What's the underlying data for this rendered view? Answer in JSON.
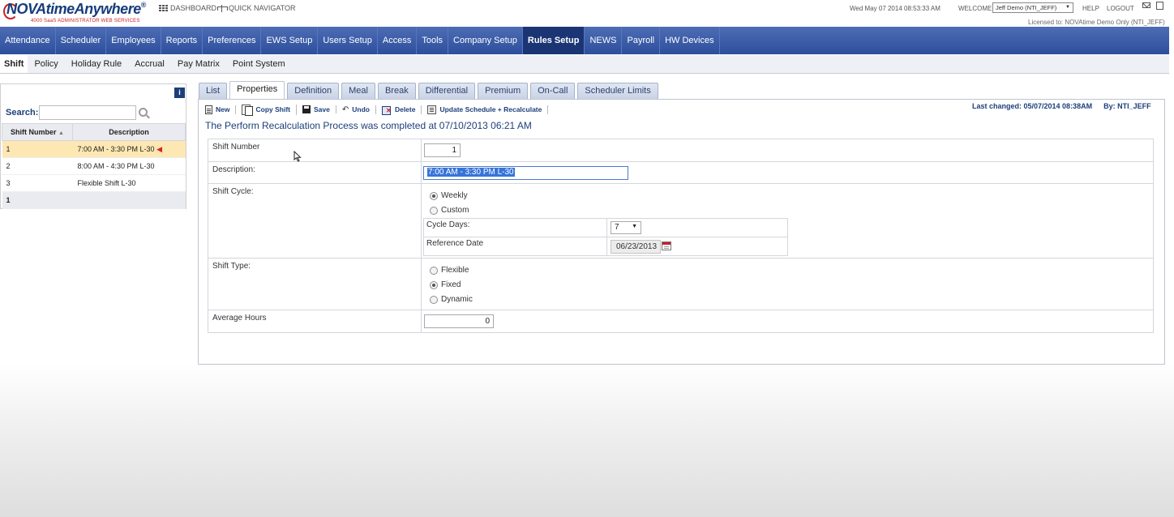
{
  "header": {
    "brand": "NOVAtimeAnywhere",
    "brand_reg": "®",
    "tagline": "4000 SaaS ADMINISTRATOR WEB SERVICES",
    "dashboard": "DASHBOARD",
    "quick_navigator": "QUICK NAVIGATOR",
    "datetime": "Wed May 07 2014 08:53:33 AM",
    "welcome": "WELCOME",
    "user": "Jeff Demo (NTI_JEFF)",
    "help": "HELP",
    "logout": "LOGOUT",
    "license": "Licensed to: NOVAtime Demo Only (NTI_JEFF)"
  },
  "main_nav": [
    "Attendance",
    "Scheduler",
    "Employees",
    "Reports",
    "Preferences",
    "EWS Setup",
    "Users Setup",
    "Access",
    "Tools",
    "Company Setup",
    "Rules Setup",
    "NEWS",
    "Payroll",
    "HW Devices"
  ],
  "main_nav_active": "Rules Setup",
  "sub_nav": [
    "Shift",
    "Policy",
    "Holiday Rule",
    "Accrual",
    "Pay Matrix",
    "Point System"
  ],
  "sub_nav_active": "Shift",
  "left_panel": {
    "info_label": "i",
    "search_label": "Search:",
    "search_value": "",
    "columns": [
      "Shift Number",
      "Description"
    ],
    "sort_indicator": "▲",
    "rows": [
      {
        "number": "1",
        "description": "7:00 AM - 3:30 PM L-30",
        "selected": true
      },
      {
        "number": "2",
        "description": "8:00 AM - 4:30 PM L-30",
        "selected": false
      },
      {
        "number": "3",
        "description": "Flexible Shift L-30",
        "selected": false
      }
    ],
    "footer_number": "1"
  },
  "tabs": [
    "List",
    "Properties",
    "Definition",
    "Meal",
    "Break",
    "Differential",
    "Premium",
    "On-Call",
    "Scheduler Limits"
  ],
  "active_tab": "Properties",
  "toolbar": {
    "new": "New",
    "copy_shift": "Copy Shift",
    "save": "Save",
    "undo": "Undo",
    "delete": "Delete",
    "update": "Update Schedule + Recalculate"
  },
  "last_changed": "Last changed: 05/07/2014 08:38AM",
  "last_changed_by": "By: NTI_JEFF",
  "message": "The Perform Recalculation Process was completed at 07/10/2013 06:21 AM",
  "form": {
    "shift_number_label": "Shift Number",
    "shift_number_value": "1",
    "description_label": "Description:",
    "description_value": "7:00 AM - 3:30 PM L-30",
    "shift_cycle_label": "Shift Cycle:",
    "cycle_weekly": "Weekly",
    "cycle_custom": "Custom",
    "cycle_selected": "Weekly",
    "cycle_days_label": "Cycle Days:",
    "cycle_days_value": "7",
    "reference_date_label": "Reference Date",
    "reference_date_value": "06/23/2013",
    "shift_type_label": "Shift Type:",
    "type_flexible": "Flexible",
    "type_fixed": "Fixed",
    "type_dynamic": "Dynamic",
    "type_selected": "Fixed",
    "average_hours_label": "Average Hours",
    "average_hours_value": "0"
  },
  "colors": {
    "nav_bg": "#2d4f9c",
    "nav_active": "#1b3574",
    "selected_row": "#fde7b2",
    "accent_text": "#1c3f7a"
  }
}
